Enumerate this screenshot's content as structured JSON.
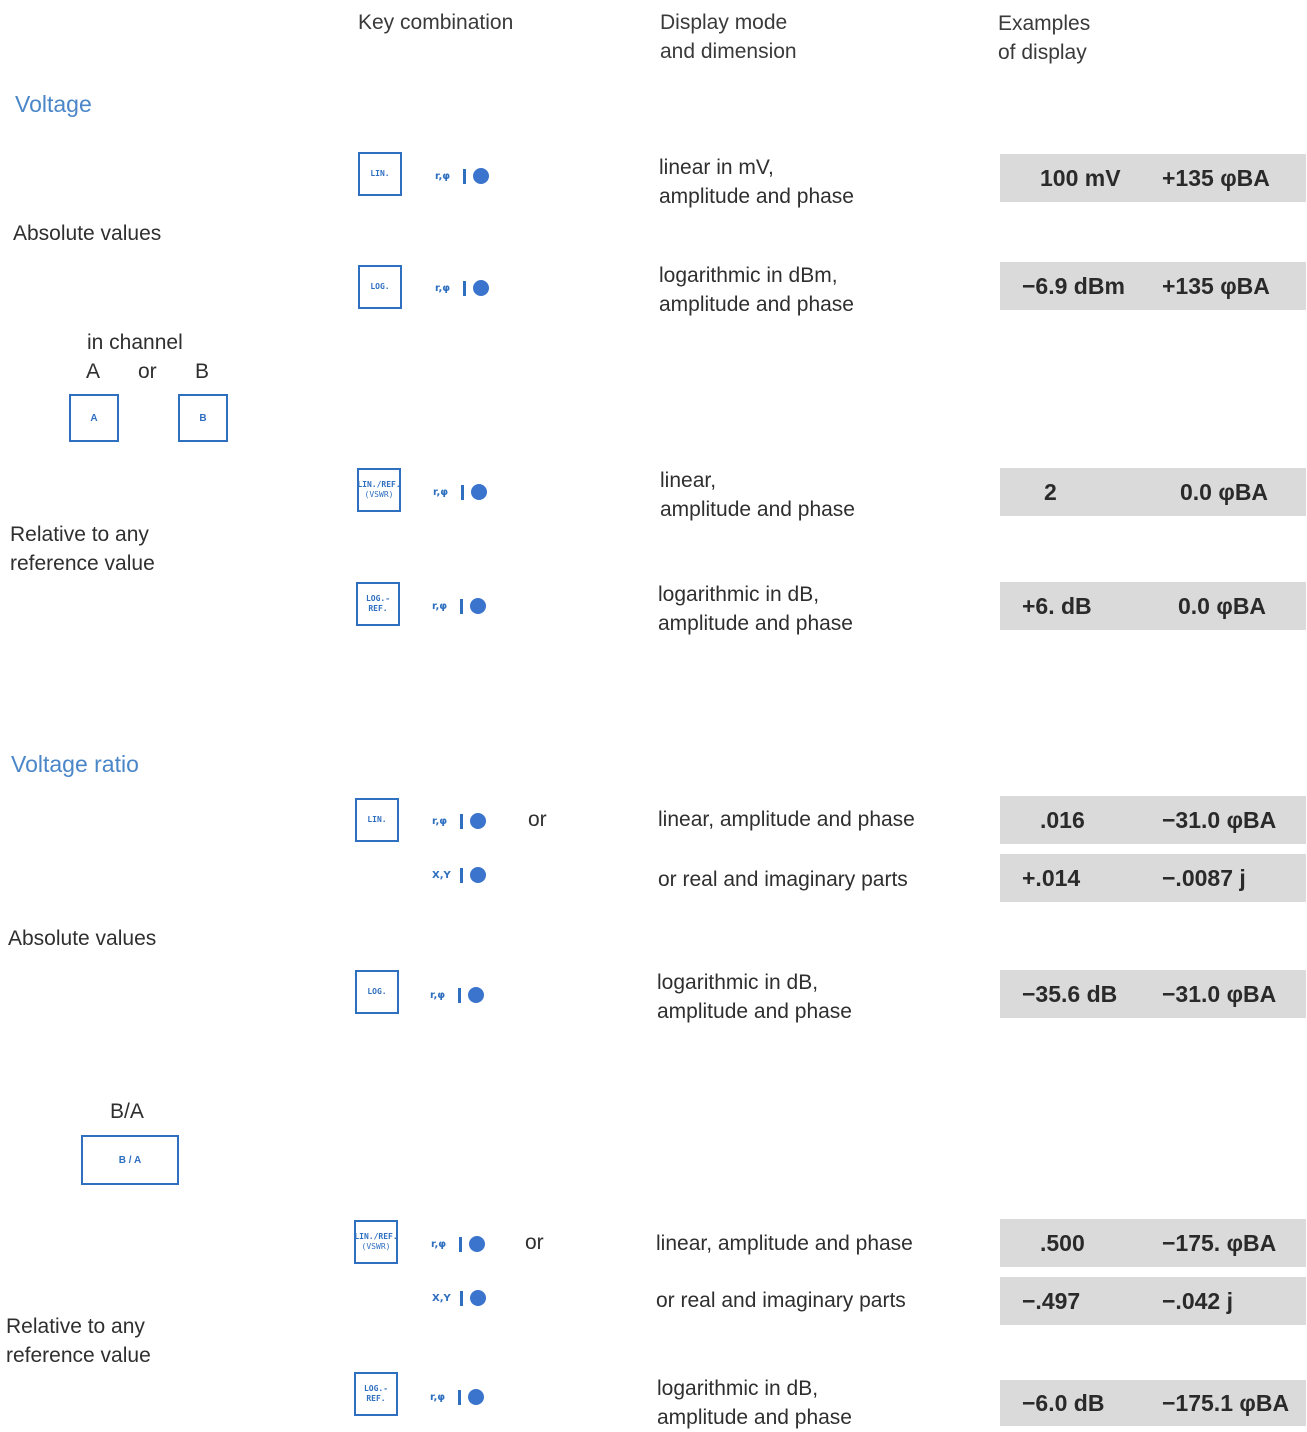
{
  "headers": {
    "key": "Key combination",
    "mode": [
      "Display mode",
      "and dimension"
    ],
    "examples": [
      "Examples",
      "of display"
    ]
  },
  "sections": {
    "voltage": "Voltage",
    "ratio": "Voltage ratio"
  },
  "groups": {
    "abs1": "Absolute values",
    "rel1": [
      "Relative to any",
      "reference value"
    ],
    "abs2": "Absolute values",
    "rel2": [
      "Relative to any",
      "reference value"
    ]
  },
  "channel": {
    "title": "in channel",
    "a": "A",
    "or": "or",
    "b": "B",
    "key_a": "A",
    "key_b": "B",
    "ba_title": "B/A",
    "key_ba": "B / A"
  },
  "keys": {
    "lin": "LIN.",
    "log": "LOG.",
    "lin_ref": "LIN./REF.",
    "vswr": "(VSWR)",
    "log_ref": "LOG.-REF."
  },
  "indicators": {
    "rphi": "r,φ",
    "xy": "X,Y"
  },
  "or_word": "or",
  "rows": [
    {
      "mode": [
        "linear in mV,",
        "amplitude and phase"
      ],
      "amp": "100 mV",
      "phase": "+135 φBA"
    },
    {
      "mode": [
        "logarithmic in dBm,",
        "amplitude and phase"
      ],
      "amp": "−6.9 dBm",
      "phase": "+135 φBA"
    },
    {
      "mode": [
        "linear,",
        "amplitude and phase"
      ],
      "amp": "2",
      "phase": "0.0 φBA"
    },
    {
      "mode": [
        "logarithmic in dB,",
        "amplitude and phase"
      ],
      "amp": "+6. dB",
      "phase": "0.0 φBA"
    },
    {
      "mode": [
        "linear, amplitude and phase"
      ],
      "amp": ".016",
      "phase": "−31.0 φBA"
    },
    {
      "mode": [
        "or real and imaginary parts"
      ],
      "amp": "+.014",
      "phase": "−.0087 j"
    },
    {
      "mode": [
        "logarithmic in dB,",
        "amplitude and phase"
      ],
      "amp": "−35.6 dB",
      "phase": "−31.0 φBA"
    },
    {
      "mode": [
        "linear, amplitude and phase"
      ],
      "amp": ".500",
      "phase": "−175. φBA"
    },
    {
      "mode": [
        "or real and imaginary parts"
      ],
      "amp": "−.497",
      "phase": "−.042 j"
    },
    {
      "mode": [
        "logarithmic in dB,",
        "amplitude and phase"
      ],
      "amp": "−6.0 dB",
      "phase": "−175.1 φBA"
    }
  ],
  "colors": {
    "accent": "#4a86c8",
    "key_blue": "#2f6fc0",
    "display_bg": "#dadada"
  }
}
